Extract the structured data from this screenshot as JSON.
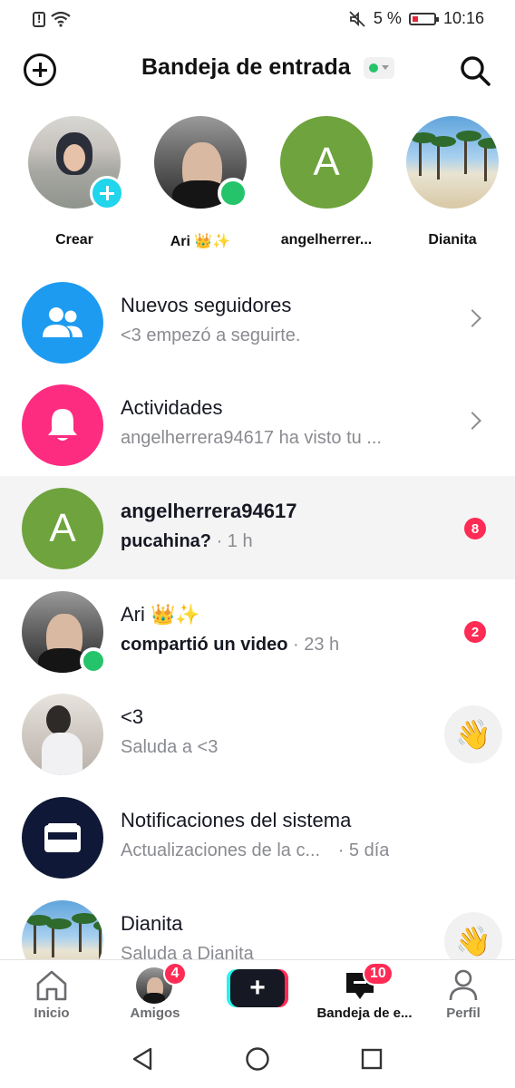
{
  "status_bar": {
    "battery": "5 %",
    "time": "10:16"
  },
  "header": {
    "title": "Bandeja de entrada"
  },
  "stories": [
    {
      "name": "Crear"
    },
    {
      "name": "Ari 👑✨"
    },
    {
      "name": "angelherrer...",
      "initial": "A"
    },
    {
      "name": "Dianita"
    }
  ],
  "rows": {
    "followers": {
      "title": "Nuevos seguidores",
      "subtitle": "<3 empezó a seguirte."
    },
    "activity": {
      "title": "Actividades",
      "subtitle": "angelherrera94617 ha visto tu ..."
    },
    "angel": {
      "initial": "A",
      "title": "angelherrera94617",
      "message": "pucahina?",
      "time": " · 1 h",
      "count": "8"
    },
    "ari": {
      "title": "Ari 👑✨",
      "message": "compartió un video",
      "time": " · 23 h",
      "count": "2"
    },
    "three": {
      "title": "<3",
      "subtitle": "Saluda a <3",
      "wave": "👋"
    },
    "system": {
      "title": "Notificaciones del sistema",
      "subtitle": "Actualizaciones de la c...",
      "time": "· 5 día"
    },
    "dianita": {
      "title": "Dianita",
      "subtitle": "Saluda a Dianita",
      "wave": "👋"
    }
  },
  "bottom_nav": {
    "home": "Inicio",
    "friends": "Amigos",
    "friends_badge": "4",
    "inbox": "Bandeja de e...",
    "inbox_badge": "10",
    "profile": "Perfil"
  },
  "colors": {
    "accent_red": "#fe2c55",
    "online_green": "#25c46b",
    "followers_blue": "#1d9bf0",
    "activity_pink": "#fe2c80"
  }
}
